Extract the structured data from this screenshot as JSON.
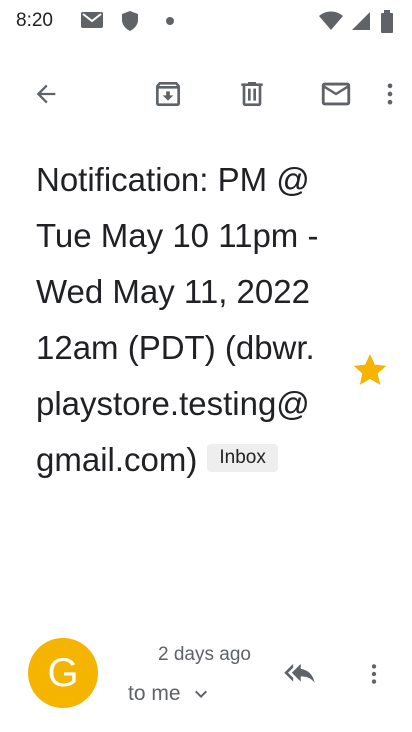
{
  "status_bar": {
    "time": "8:20"
  },
  "toolbar": {
    "back": "back-arrow-icon",
    "archive": "archive-icon",
    "delete": "trash-icon",
    "mark_unread": "mail-icon",
    "more": "more-vert-icon"
  },
  "email": {
    "subject": "Notification: PM @ Tue May 10 11pm - Wed May 11, 2022 12am (PDT) (dbwr.playstore.testing@gmail.com)",
    "label": "Inbox",
    "starred": true,
    "star_color": "#F4B400"
  },
  "sender": {
    "avatar_letter": "G",
    "avatar_color": "#F4B400",
    "time": "2 days ago",
    "recipient": "to me"
  }
}
